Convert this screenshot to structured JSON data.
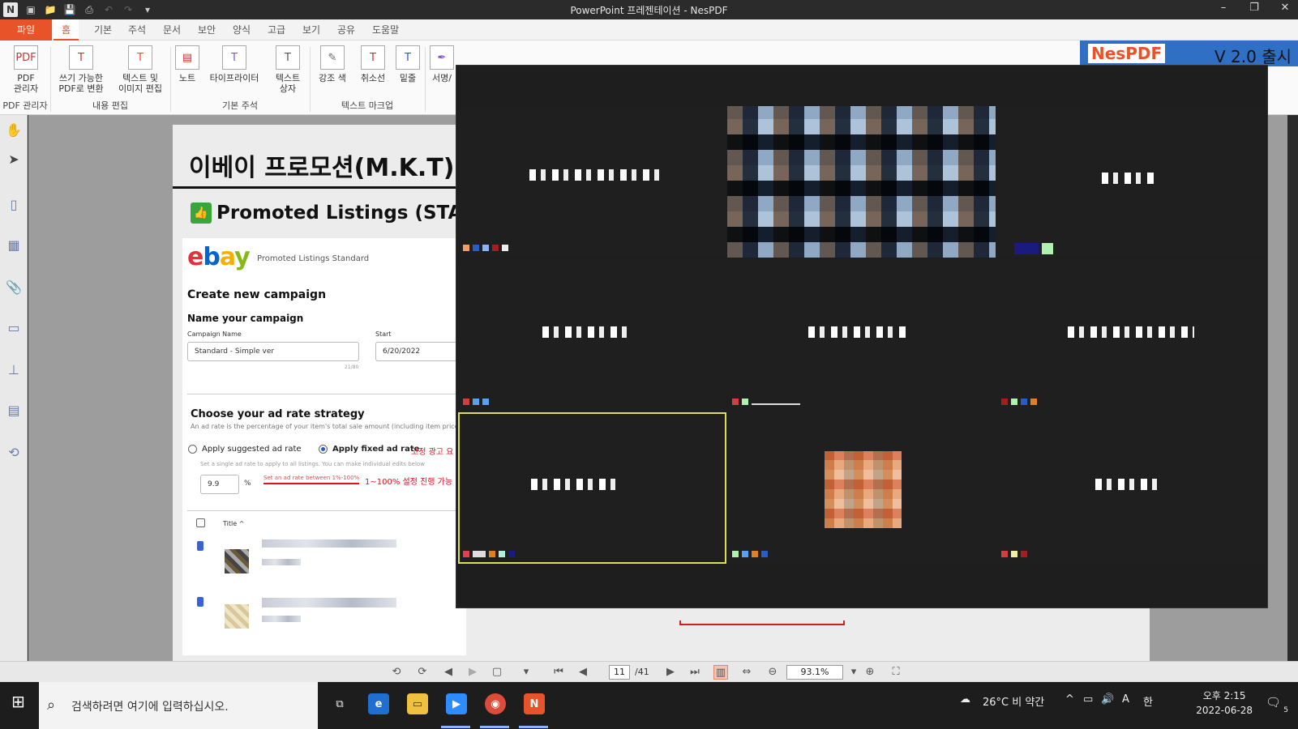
{
  "window": {
    "title": "PowerPoint 프레젠테이션 - NesPDF",
    "controls": [
      "–",
      "❐",
      "✕"
    ]
  },
  "menu": {
    "tabs": [
      "파일",
      "홈",
      "기본",
      "주석",
      "문서",
      "보안",
      "양식",
      "고급",
      "보기",
      "공유",
      "도움말"
    ]
  },
  "ribbon": {
    "pdf_manager_label": "PDF\n관리자",
    "writable_pdf_label": "쓰기 가능한\nPDF로 변환",
    "text_image_edit_label": "텍스트 및\n이미지 편집",
    "note_label": "노트",
    "typewriter_label": "타이프라이터",
    "textbox_label": "텍스트\n상자",
    "highlight_label": "강조 색",
    "strikeout_label": "취소선",
    "underline_label": "밑줄",
    "sign_label": "서명/",
    "group_pdf_manager": "PDF 관리자",
    "group_content_edit": "내용 편집",
    "group_basic_annotation": "기본 주석",
    "group_text_markup": "텍스트 마크업"
  },
  "banner": {
    "logo": "NesPDF",
    "version": "V 2.0 출시"
  },
  "document": {
    "title": "이베이 프로모션(M.K.T)",
    "promo_heading": "Promoted Listings (STANDARD",
    "ebay": {
      "logo": [
        "e",
        "b",
        "a",
        "y"
      ],
      "product": "Promoted Listings Standard",
      "create_campaign": "Create new campaign",
      "name_campaign": "Name your campaign",
      "campaign_name_label": "Campaign Name",
      "campaign_name_value": "Standard - Simple ver",
      "char_count": "21/80",
      "start_label": "Start",
      "start_value": "6/20/2022",
      "strategy_title": "Choose your ad rate strategy",
      "strategy_sub": "An ad rate is the percentage of your item's total sale amount (including item price,",
      "opt_suggested": "Apply suggested ad rate",
      "opt_fixed": "Apply fixed ad rate",
      "fixed_note_kr": "고정 광고 요",
      "single_rate_hint": "Set a single ad rate to apply to all listings. You can make individual edits below",
      "rate_value": "9.9",
      "rate_unit": "%",
      "rate_range_hint": "Set an ad rate between 1%-100%",
      "rate_range_kr": "1~100% 설정 진행 가능",
      "table_title_col": "Title ^"
    }
  },
  "video": {
    "tiles": 9,
    "active_tile": 6
  },
  "navbar": {
    "current_page": "11",
    "total_pages": "/41",
    "zoom": "93.1%"
  },
  "taskbar": {
    "search_placeholder": "검색하려면 여기에 입력하십시오.",
    "weather": "26°C  비 약간",
    "time": "오후 2:15",
    "date": "2022-06-28",
    "ime": "한",
    "ime_mode": "A",
    "notif_count": "5"
  },
  "colors": {
    "accent": "#e8532a",
    "selection_outline": "#dede58"
  }
}
